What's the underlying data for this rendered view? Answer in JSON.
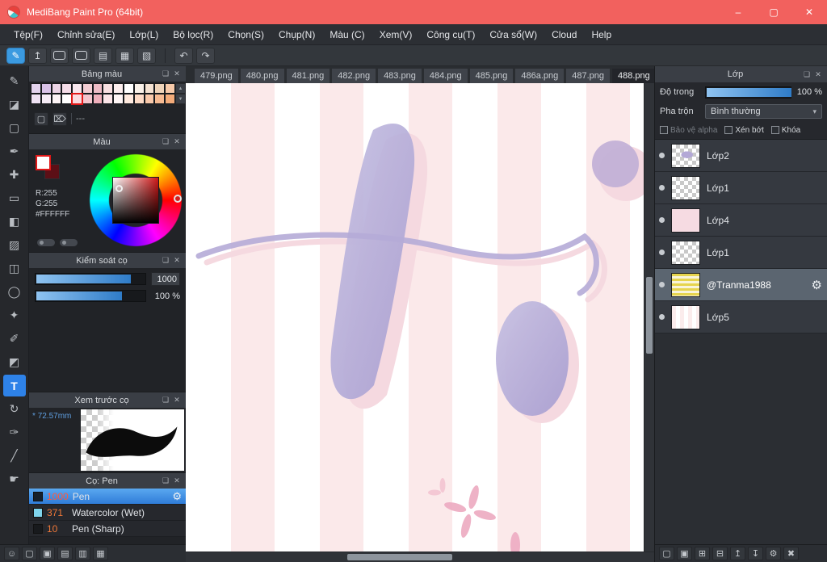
{
  "window": {
    "title": "MediBang Paint Pro (64bit)",
    "controls": {
      "minimize": "–",
      "maximize": "▢",
      "close": "✕"
    }
  },
  "menu": {
    "items": [
      "Tệp(F)",
      "Chỉnh sửa(E)",
      "Lớp(L)",
      "Bộ lọc(R)",
      "Chọn(S)",
      "Chụp(N)",
      "Màu (C)",
      "Xem(V)",
      "Công cụ(T)",
      "Cửa sổ(W)",
      "Cloud",
      "Help"
    ]
  },
  "toolbar": {
    "buttons": [
      {
        "name": "cloud-save",
        "glyph": "✎",
        "cls": "save"
      },
      {
        "name": "upload",
        "glyph": "↥"
      },
      {
        "name": "comment",
        "glyph": "",
        "cls": "bubble"
      },
      {
        "name": "message",
        "glyph": "",
        "cls": "bubble"
      },
      {
        "name": "document",
        "glyph": "▤"
      },
      {
        "name": "storyboard",
        "glyph": "▦"
      },
      {
        "name": "material",
        "glyph": "▧"
      }
    ],
    "undo": "↶",
    "redo": "↷"
  },
  "tabs": {
    "items": [
      {
        "label": "479.png"
      },
      {
        "label": "480.png"
      },
      {
        "label": "481.png"
      },
      {
        "label": "482.png"
      },
      {
        "label": "483.png"
      },
      {
        "label": "484.png"
      },
      {
        "label": "485.png"
      },
      {
        "label": "486a.png"
      },
      {
        "label": "487.png"
      },
      {
        "label": "488.png",
        "selected": true
      }
    ]
  },
  "tools": [
    {
      "name": "pen",
      "glyph": "✎"
    },
    {
      "name": "eraser",
      "glyph": "◪"
    },
    {
      "name": "select",
      "glyph": "▢"
    },
    {
      "name": "control-pen",
      "glyph": "✒"
    },
    {
      "name": "move",
      "glyph": "✚"
    },
    {
      "name": "shape",
      "glyph": "▭"
    },
    {
      "name": "bucket",
      "glyph": "◧"
    },
    {
      "name": "gradient",
      "glyph": "▨"
    },
    {
      "name": "select-rect",
      "glyph": "◫"
    },
    {
      "name": "select-ellipse",
      "glyph": "◯"
    },
    {
      "name": "magic-wand",
      "glyph": "✦"
    },
    {
      "name": "select-pen",
      "glyph": "✐"
    },
    {
      "name": "select-eraser",
      "glyph": "◩"
    },
    {
      "name": "text",
      "glyph": "T",
      "selected": true
    },
    {
      "name": "rotate",
      "glyph": "↻"
    },
    {
      "name": "operation",
      "glyph": "✑"
    },
    {
      "name": "divide",
      "glyph": "╱"
    },
    {
      "name": "hand",
      "glyph": "☛"
    }
  ],
  "panels": {
    "header_icons": {
      "popout": "❏",
      "close": "✕"
    },
    "palette": {
      "title": "Bảng màu",
      "rows": [
        [
          "#e3d3ee",
          "#d9c2e8",
          "#ecd4e6",
          "#f4dce8",
          "#f8e7ee",
          "#f3cdd3",
          "#eebcc6",
          "#f8dfe1",
          "#fdeeee",
          "#ffffff",
          "#f9f1e9",
          "#f4e2d2",
          "#eed3b9",
          "#f6c9a9"
        ],
        [
          "#efe2f4",
          "#f6ecf6",
          "#fdf4f6",
          "#ffffff",
          "#fadbe0",
          "#f5c6ce",
          "#f0b0bc",
          "#fbe5e8",
          "#fff6f6",
          "#ffeadf",
          "#fddbc7",
          "#f9c9ab",
          "#f6ba92",
          "#f3ab7a"
        ]
      ],
      "selected": {
        "row": 1,
        "col": 4
      },
      "scroll_up": "▲",
      "scroll_down": "▼",
      "actions": [
        {
          "name": "new-color",
          "glyph": "▢"
        },
        {
          "name": "delete-color",
          "glyph": "⌦"
        }
      ],
      "divider_label": "---"
    },
    "color": {
      "title": "Màu",
      "r_label": "R:255",
      "g_label": "G:255",
      "hex_label": "#FFFFFF"
    },
    "brush_control": {
      "title": "Kiểm soát cọ",
      "size_value": "1000",
      "opacity_value": "100 %"
    },
    "brush_preview": {
      "title": "Xem trước cọ",
      "size_prefix": "*",
      "size_label": "72.57mm"
    },
    "brushes": {
      "title": "Cọ: Pen",
      "items": [
        {
          "size": "1000",
          "name": "Pen",
          "swatch": "#16202c",
          "selected": true,
          "gear": "⚙"
        },
        {
          "size": "371",
          "name": "Watercolor (Wet)",
          "swatch": "#7fd4ec"
        },
        {
          "size": "10",
          "name": "Pen (Sharp)",
          "swatch": "#181a1d"
        }
      ]
    }
  },
  "left_bottom_icons": [
    {
      "name": "account",
      "glyph": "☺"
    },
    {
      "name": "new-canvas",
      "glyph": "▢"
    },
    {
      "name": "open",
      "glyph": "▣"
    },
    {
      "name": "pages",
      "glyph": "▤"
    },
    {
      "name": "folder",
      "glyph": "▥"
    },
    {
      "name": "grid",
      "glyph": "▦"
    }
  ],
  "layers": {
    "title": "Lớp",
    "opacity_label": "Độ trong",
    "opacity_value": "100 %",
    "blend_label": "Pha trộn",
    "blend_value": "Bình thường",
    "blend_caret": "▾",
    "check_items": [
      {
        "label": "Bảo vệ alpha",
        "muted": true
      },
      {
        "label": "Xén bớt"
      },
      {
        "label": "Khóa"
      }
    ],
    "items": [
      {
        "name": "Lớp2",
        "thumb": "checker-art"
      },
      {
        "name": "Lớp1",
        "thumb": "checker"
      },
      {
        "name": "Lớp4",
        "thumb": "pink"
      },
      {
        "name": "Lớp1",
        "thumb": "checker"
      },
      {
        "name": "@Tranma1988",
        "thumb": "stripes",
        "selected": true,
        "gear": "⚙"
      },
      {
        "name": "Lớp5",
        "thumb": "white-stripes"
      }
    ],
    "bottom_icons": [
      {
        "name": "new-layer",
        "glyph": "▢"
      },
      {
        "name": "new-folder",
        "glyph": "▣"
      },
      {
        "name": "duplicate",
        "glyph": "⊞"
      },
      {
        "name": "merge",
        "glyph": "⊟"
      },
      {
        "name": "move-up",
        "glyph": "↥"
      },
      {
        "name": "move-down",
        "glyph": "↧"
      },
      {
        "name": "settings",
        "glyph": "⚙"
      },
      {
        "name": "delete",
        "glyph": "✖"
      }
    ]
  },
  "colors": {
    "titlebar": "#f2615e",
    "accent_blue": "#2f7cd8",
    "tool_selected": "#2e82e8",
    "canvas_stripe": "#fbe9ea",
    "artwork_lavender": "#b5abd7",
    "artwork_pink": "#f5d9e0"
  }
}
